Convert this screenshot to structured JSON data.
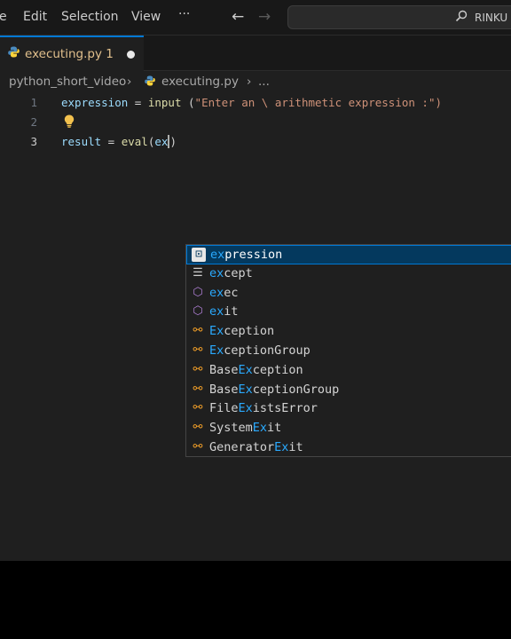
{
  "menu": {
    "partial_left": "e",
    "edit": "Edit",
    "selection": "Selection",
    "view": "View",
    "more": "···"
  },
  "nav": {
    "back": "←",
    "forward": "→"
  },
  "search": {
    "icon": "search-icon",
    "text": "RINKU"
  },
  "tab": {
    "label": "executing.py 1",
    "modified": true
  },
  "breadcrumb": {
    "folder": "python_short_video",
    "sep1": "›",
    "file": "executing.py",
    "sep2": "›",
    "more": "..."
  },
  "editor": {
    "line_numbers": [
      "1",
      "2",
      "3"
    ],
    "line1": {
      "var": "expression",
      "eq": " = ",
      "fn": "input",
      "paren": " (",
      "str": "\"Enter an \\ arithmetic expression :\")"
    },
    "line3": {
      "var": "result",
      "eq": " = ",
      "fn": "eval",
      "paren": "(",
      "typed": "ex",
      "close": ")"
    }
  },
  "suggest": {
    "match": "ex",
    "items": [
      {
        "kind": "variable",
        "pre": "",
        "mid": "ex",
        "post": "pression"
      },
      {
        "kind": "keyword",
        "pre": "",
        "mid": "ex",
        "post": "cept"
      },
      {
        "kind": "function",
        "pre": "",
        "mid": "ex",
        "post": "ec"
      },
      {
        "kind": "function",
        "pre": "",
        "mid": "ex",
        "post": "it"
      },
      {
        "kind": "class",
        "pre": "",
        "mid": "Ex",
        "post": "ception"
      },
      {
        "kind": "class",
        "pre": "",
        "mid": "Ex",
        "post": "ceptionGroup"
      },
      {
        "kind": "class",
        "pre": "Base",
        "mid": "Ex",
        "post": "ception"
      },
      {
        "kind": "class",
        "pre": "Base",
        "mid": "Ex",
        "post": "ceptionGroup"
      },
      {
        "kind": "class",
        "pre": "File",
        "mid": "Ex",
        "post": "istsError"
      },
      {
        "kind": "class",
        "pre": "System",
        "mid": "Ex",
        "post": "it"
      },
      {
        "kind": "class",
        "pre": "Generator",
        "mid": "Ex",
        "post": "it"
      }
    ]
  },
  "colors": {
    "accent": "#0078d4",
    "match": "#2aaaff",
    "modified_tab": "#e2c08d",
    "class_icon": "#ee9d28",
    "function_icon": "#b180d7"
  }
}
